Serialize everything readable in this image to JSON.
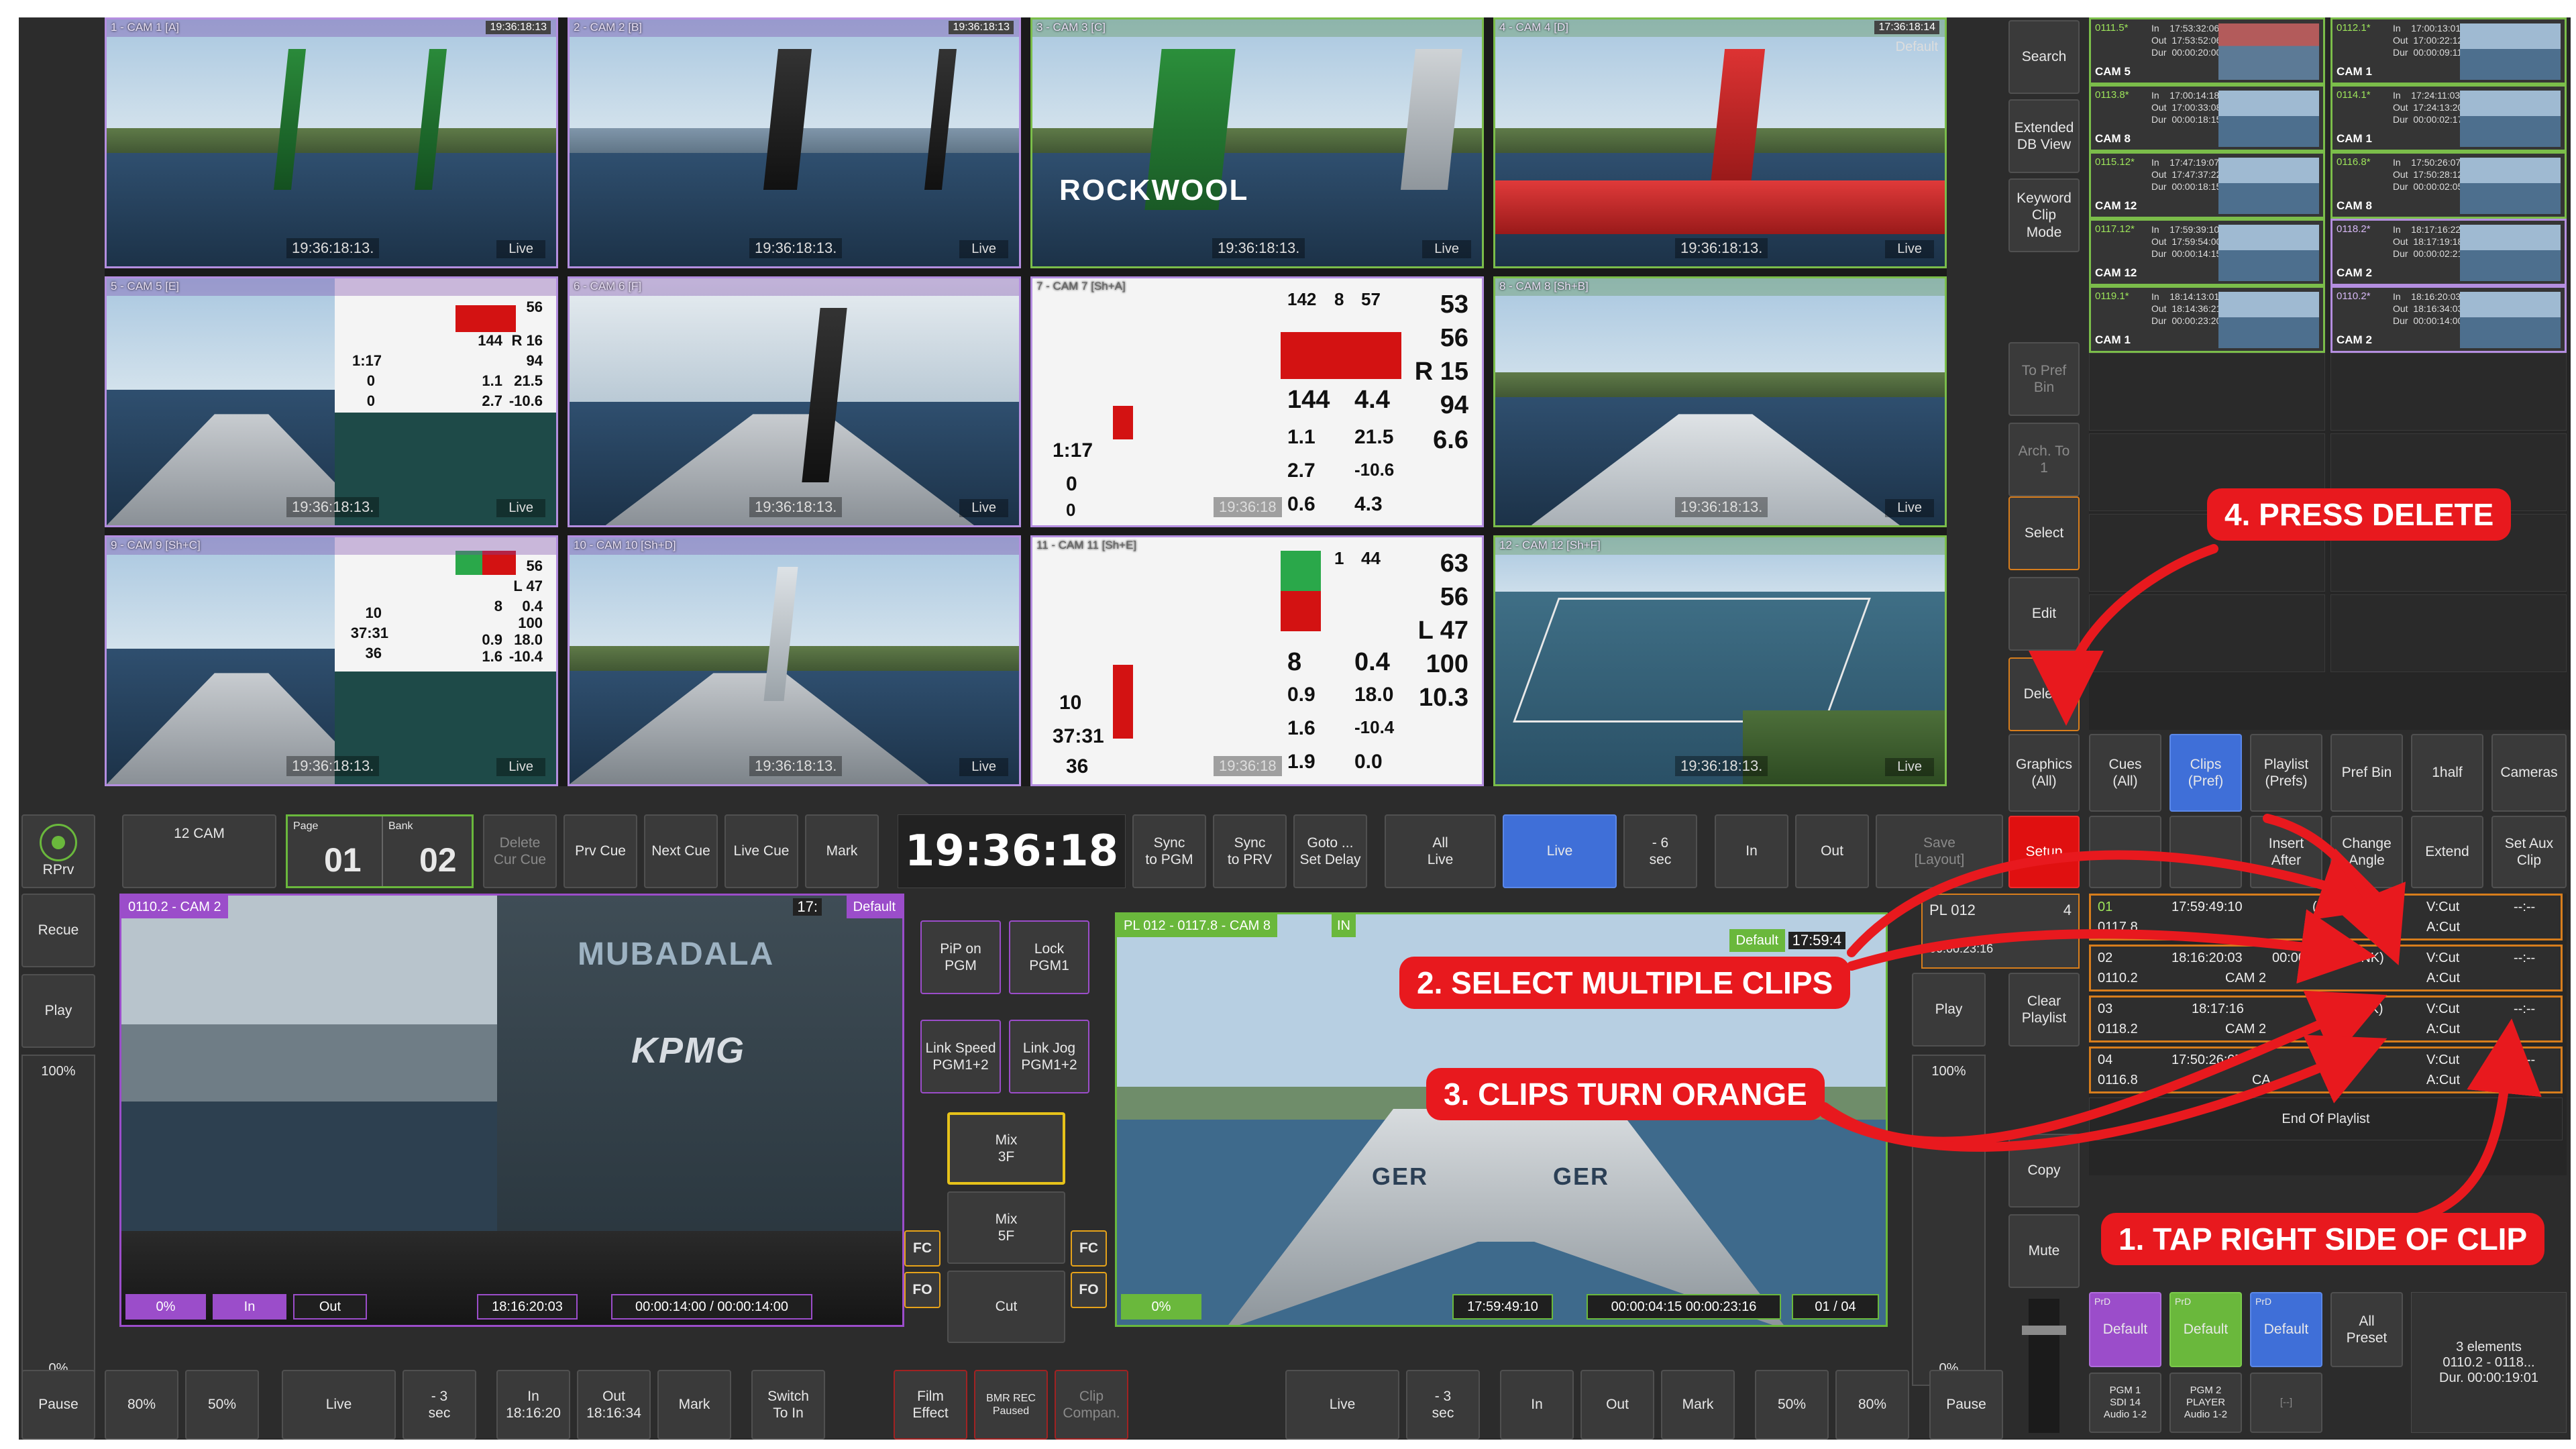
{
  "cameras": [
    {
      "label": "1 - CAM 1 [A]",
      "time": "19:36:18:13.",
      "live": "Live",
      "tc": "19:36:18:13"
    },
    {
      "label": "2 - CAM 2 [B]",
      "time": "19:36:18:13.",
      "live": "Live",
      "tc": "19:36:18:13"
    },
    {
      "label": "3 - CAM 3 [C]",
      "time": "19:36:18:13.",
      "live": "Live",
      "tc": ""
    },
    {
      "label": "4 - CAM 4 [D]",
      "time": "19:36:18:13.",
      "live": "Live",
      "tc": "17:36:18:14",
      "default": "Default"
    },
    {
      "label": "5 - CAM 5 [E]",
      "time": "19:36:18:13.",
      "live": "Live"
    },
    {
      "label": "6 - CAM 6 [F]",
      "time": "19:36:18:13.",
      "live": "Live"
    },
    {
      "label": "7 - CAM 7 [Sh+A]",
      "time": "19:36:18",
      "live": ""
    },
    {
      "label": "8 - CAM 8 [Sh+B]",
      "time": "19:36:18:13.",
      "live": "Live"
    },
    {
      "label": "9 - CAM 9 [Sh+C]",
      "time": "19:36:18:13.",
      "live": "Live"
    },
    {
      "label": "10 - CAM 10 [Sh+D]",
      "time": "19:36:18:13.",
      "live": "Live"
    },
    {
      "label": "11 - CAM 11 [Sh+E]",
      "time": "19:36:18",
      "live": ""
    },
    {
      "label": "12 - CAM 12 [Sh+F]",
      "time": "19:36:18:13.",
      "live": "Live"
    }
  ],
  "graphics": {
    "g5": [
      "56",
      "144",
      "R 16",
      "94",
      "1.1",
      "21.5",
      "2.7",
      "-10.6",
      "1:17",
      "0",
      "0"
    ],
    "g7": [
      "142",
      "8",
      "57",
      "53",
      "56",
      "144",
      "4.4",
      "R 15",
      "94",
      "1.1",
      "21.5",
      "6.6",
      "2.7",
      "-10.6",
      "0.6",
      "4.3",
      "1:17",
      "0",
      "0"
    ],
    "g9": [
      "56",
      "L 47",
      "8",
      "0.4",
      "100",
      "0.9",
      "18.0",
      "1.6",
      "-10.4",
      "10",
      "37:31",
      "36"
    ],
    "g11": [
      "1",
      "44",
      "63",
      "56",
      "L 47",
      "8",
      "0.4",
      "100",
      "0.9",
      "18.0",
      "10.3",
      "1.6",
      "-10.4",
      "1.9",
      "0.0",
      "10",
      "37:31",
      "36"
    ]
  },
  "brand_text": {
    "rockwool": "ROCKWOOL",
    "mubadala": "MUBADALA",
    "kpmg": "KPMG",
    "ger": "GER"
  },
  "right_panel": {
    "side_buttons": {
      "search": "Search",
      "extended": "Extended\nDB View",
      "keyword": "Keyword\nClip\nMode",
      "to_pref_bin": "To Pref\nBin",
      "arch_to": "Arch. To\n1",
      "select": "Select",
      "edit": "Edit",
      "delete": "Delete"
    },
    "clips": [
      {
        "id": "0111.5*",
        "io": "In    17:53:32:06\nOut  17:53:52:06\nDur  00:00:20:00",
        "cam": "CAM 5"
      },
      {
        "id": "0112.1*",
        "io": "In    17:00:13:01\nOut  17:00:22:12\nDur  00:00:09:11",
        "cam": "CAM 1"
      },
      {
        "id": "0113.8*",
        "io": "In    17:00:14:18\nOut  17:00:33:08\nDur  00:00:18:15",
        "cam": "CAM 8"
      },
      {
        "id": "0114.1*",
        "io": "In    17:24:11:03\nOut  17:24:13:20\nDur  00:00:02:17",
        "cam": "CAM 1"
      },
      {
        "id": "0115.12*",
        "io": "In    17:47:19:07\nOut  17:47:37:22\nDur  00:00:18:15",
        "cam": "CAM 12"
      },
      {
        "id": "0116.8*",
        "io": "In    17:50:26:07\nOut  17:50:28:12\nDur  00:00:02:05",
        "cam": "CAM 8"
      },
      {
        "id": "0117.12*",
        "io": "In    17:59:39:10\nOut  17:59:54:00\nDur  00:00:14:15",
        "cam": "CAM 12"
      },
      {
        "id": "0118.2*",
        "io": "In    18:17:16:22\nOut  18:17:19:18\nDur  00:00:02:21",
        "cam": "CAM 2"
      },
      {
        "id": "0119.1*",
        "io": "In    18:14:13:01\nOut  18:14:36:21\nDur  00:00:23:20",
        "cam": "CAM 1"
      },
      {
        "id": "0110.2*",
        "io": "In    18:16:20:03\nOut  18:16:34:03\nDur  00:00:14:00",
        "cam": "CAM 2"
      }
    ],
    "tabs": [
      "Graphics\n(All)",
      "Cues\n(All)",
      "Clips\n(Pref)",
      "Playlist\n(Prefs)",
      "Pref Bin",
      "1half",
      "Cameras"
    ],
    "function_row": [
      "Setup",
      "",
      "",
      "Insert\nAfter",
      "Change\nAngle",
      "Extend",
      "Set Aux\nClip"
    ],
    "playlist_header": {
      "name": "PL 012",
      "count": "4",
      "duration": "00:00:23:16"
    },
    "playlist_rows": [
      {
        "num": "01",
        "clip": "0117.8",
        "time": "17:59:49:10",
        "dur": "(UNK)",
        "cam": "",
        "v": "V:Cut",
        "a": "A:Cut",
        "x": "--:--"
      },
      {
        "num": "02",
        "clip": "0110.2",
        "time": "18:16:20:03",
        "dur": "00:00:14:00 (UNK)",
        "cam": "CAM 2",
        "v": "V:Cut",
        "a": "A:Cut",
        "x": "--:--"
      },
      {
        "num": "03",
        "clip": "0118.2",
        "time": "18:17:16",
        "dur": "(UNK)",
        "cam": "CAM 2",
        "v": "V:Cut",
        "a": "A:Cut",
        "x": "--:--"
      },
      {
        "num": "04",
        "clip": "0116.8",
        "time": "17:50:26:07",
        "dur": "",
        "cam": "CA",
        "v": "V:Cut",
        "a": "A:Cut",
        "x": "--:--"
      }
    ],
    "end_of_playlist": "End Of Playlist",
    "left_col": {
      "clear_playlist": "Clear\nPlaylist",
      "copy": "Copy",
      "mute": "Mute"
    },
    "presets": [
      {
        "tag": "PrD",
        "label": "Default"
      },
      {
        "tag": "PrD",
        "label": "Default"
      },
      {
        "tag": "PrD",
        "label": "Default"
      }
    ],
    "all_preset": "All\nPreset",
    "info": "3 elements\n0110.2 - 0118...\nDur. 00:00:19:01",
    "outputs": [
      "PGM 1\nSDI 14\nAudio 1-2",
      "PGM 2\nPLAYER\nAudio 1-2",
      "[--]"
    ]
  },
  "control_row": {
    "rprv": "RPrv",
    "cam_count": "12 CAM",
    "page_label": "Page",
    "page_value": "01",
    "bank_label": "Bank",
    "bank_value": "02",
    "buttons": [
      "Delete\nCur Cue",
      "Prv Cue",
      "Next Cue",
      "Live Cue",
      "Mark"
    ],
    "clock": "19:36:18",
    "buttons2": [
      "Sync\nto PGM",
      "Sync\nto PRV",
      "Goto ...\nSet Delay",
      "All\nLive",
      "Live",
      "- 6\nsec",
      "In",
      "Out",
      "Save\n[Layout]"
    ]
  },
  "left_column": {
    "recue": "Recue",
    "play": "Play",
    "speed_top": "100%",
    "speed_bottom": "0%"
  },
  "player1": {
    "title": "0110.2 - CAM 2",
    "default": "Default",
    "tc": "17:",
    "pct": "0%",
    "in": "In",
    "out": "Out",
    "time": "18:16:20:03",
    "dur": "00:00:14:00 / 00:00:14:00"
  },
  "player2": {
    "title": "PL 012 - 0117.8 - CAM 8",
    "in_badge": "IN",
    "default": "Default",
    "tc": "17:59:4",
    "pct": "0%",
    "time": "17:59:49:10",
    "dur": "00:00:04:15   00:00:23:16",
    "count": "01 / 04"
  },
  "mid_buttons": {
    "pip": "PiP on\nPGM",
    "lock": "Lock\nPGM1",
    "link_speed": "Link Speed\nPGM1+2",
    "link_jog": "Link Jog\nPGM1+2",
    "mix3": "Mix\n3F",
    "mix5": "Mix\n5F",
    "cut": "Cut",
    "fc": "FC",
    "fo": "FO"
  },
  "right_of_player2": {
    "play": "Play",
    "speed_top": "100%",
    "speed_bottom": "0%"
  },
  "bottom_row": {
    "left": [
      "Pause",
      "80%",
      "50%",
      "Live",
      "- 3\nsec",
      "In\n18:16:20",
      "Out\n18:16:34",
      "Mark",
      "Switch\nTo In"
    ],
    "center": [
      "Film\nEffect",
      "BMR REC\nPaused",
      "Clip\nCompan."
    ],
    "right": [
      "Live",
      "- 3\nsec",
      "In",
      "Out",
      "Mark",
      "50%",
      "80%",
      "Pause"
    ]
  },
  "annotations": {
    "step1": "1. TAP RIGHT SIDE OF CLIP",
    "step2": "2. SELECT MULTIPLE CLIPS",
    "step3": "3. CLIPS TURN ORANGE",
    "step4": "4. PRESS DELETE",
    "color": "#e8191e"
  }
}
